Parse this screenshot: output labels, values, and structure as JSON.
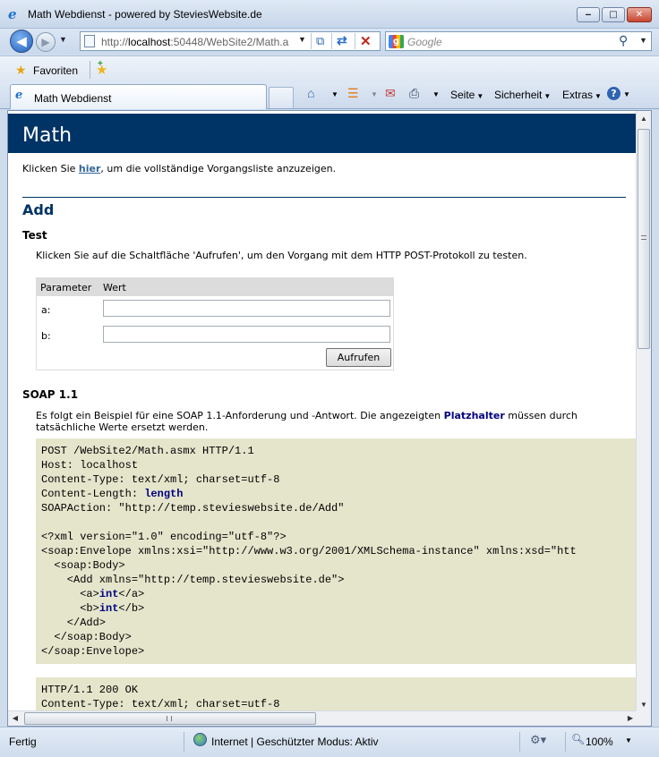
{
  "window": {
    "title": "Math Webdienst - powered by SteviesWebsite.de",
    "minimize_glyph": "‒",
    "maximize_glyph": "□",
    "close_glyph": "✕"
  },
  "toolbar": {
    "back_glyph": "◀",
    "forward_glyph": "▶",
    "address_host_prefix": "http://",
    "address_host": "localhost",
    "address_rest": ":50448/WebSite2/Math.a",
    "search_placeholder": "Google"
  },
  "favorites": {
    "label": "Favoriten"
  },
  "tab": {
    "label": "Math Webdienst"
  },
  "command_bar": {
    "page": "Seite",
    "safety": "Sicherheit",
    "tools": "Extras"
  },
  "page": {
    "banner_heading": "Math",
    "intro_before": "Klicken Sie ",
    "intro_link": "hier",
    "intro_after": ", um die vollständige Vorgangsliste anzuzeigen.",
    "operation_title": "Add",
    "test_heading": "Test",
    "test_text": "Klicken Sie auf die Schaltfläche 'Aufrufen', um den Vorgang mit dem HTTP POST-Protokoll zu testen.",
    "form": {
      "header_parameter": "Parameter",
      "header_value": "Wert",
      "param_a_label": "a:",
      "param_b_label": "b:",
      "param_a_value": "",
      "param_b_value": "",
      "invoke_button": "Aufrufen"
    },
    "soap_heading": "SOAP 1.1",
    "soap_text_before": "Es folgt ein Beispiel für eine SOAP 1.1-Anforderung und -Antwort. Die angezeigten ",
    "soap_text_placeholder": "Platzhalter",
    "soap_text_after": " müssen durch tatsächliche Werte ersetzt werden.",
    "request": {
      "line1": "POST /WebSite2/Math.asmx HTTP/1.1",
      "line2": "Host: localhost",
      "line3": "Content-Type: text/xml; charset=utf-8",
      "line4_prefix": "Content-Length: ",
      "line4_value": "length",
      "line5": "SOAPAction: \"http://temp.stevieswebsite.de/Add\"",
      "line7": "<?xml version=\"1.0\" encoding=\"utf-8\"?>",
      "line8": "<soap:Envelope xmlns:xsi=\"http://www.w3.org/2001/XMLSchema-instance\" xmlns:xsd=\"htt",
      "line9": "  <soap:Body>",
      "line10": "    <Add xmlns=\"http://temp.stevieswebsite.de\">",
      "line11_open": "      <a>",
      "line11_value": "int",
      "line11_close": "</a>",
      "line12_open": "      <b>",
      "line12_value": "int",
      "line12_close": "</b>",
      "line13": "    </Add>",
      "line14": "  </soap:Body>",
      "line15": "</soap:Envelope>"
    },
    "response": {
      "line1": "HTTP/1.1 200 OK",
      "line2": "Content-Type: text/xml; charset=utf-8"
    }
  },
  "statusbar": {
    "status": "Fertig",
    "zone": "Internet | Geschützter Modus: Aktiv",
    "zoom": "100%"
  }
}
